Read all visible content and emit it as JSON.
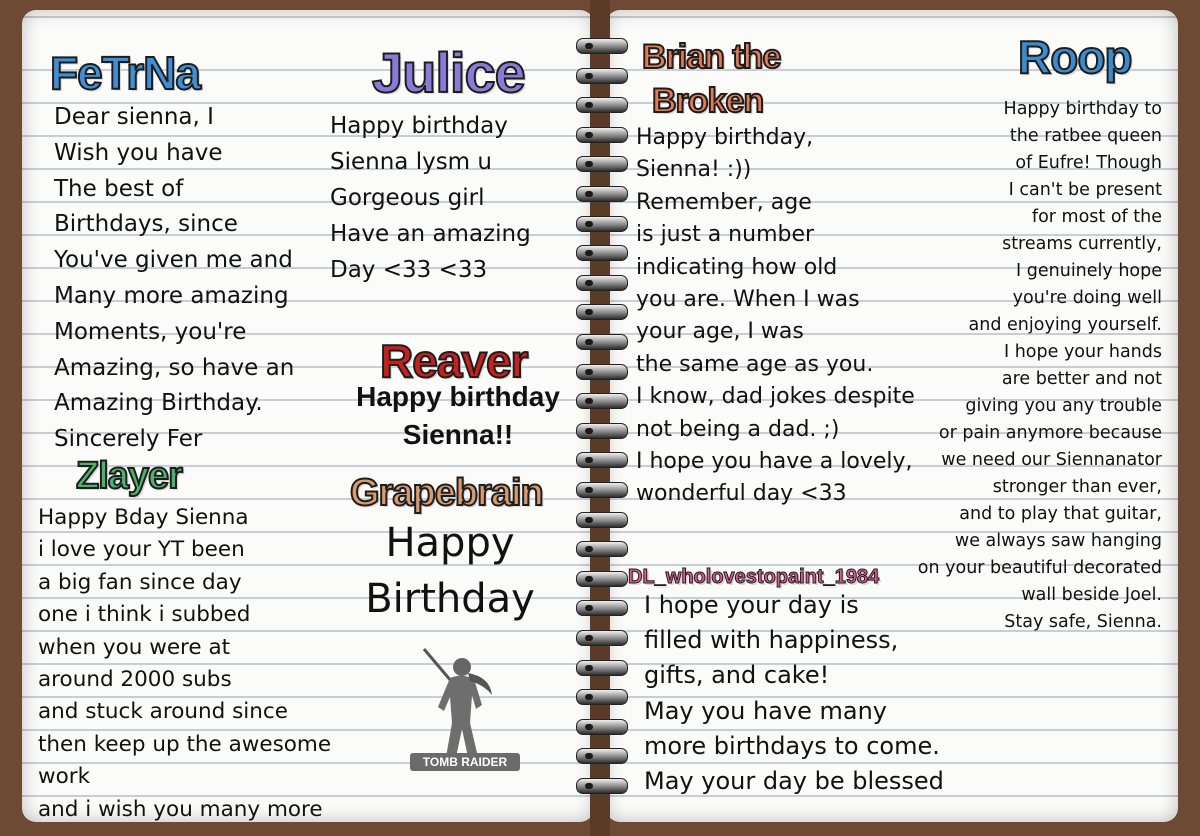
{
  "colors": {
    "fetrna": "#3e8fd6",
    "julice": "#8b7bd8",
    "reaver": "#c8201d",
    "zlayer": "#4bb36a",
    "grapebrain": "#d99a6c",
    "brian": "#e57b55",
    "roop": "#3a8ccc",
    "dl": "#e05a95"
  },
  "left": {
    "fetrna": {
      "name": "FeTrNa",
      "message": "Dear sienna, I\nWish you have\nThe best of\nBirthdays, since\nYou've given me and\nMany more amazing\nMoments, you're\nAmazing, so have an\nAmazing Birthday.\nSincerely Fer"
    },
    "julice": {
      "name": "Julice",
      "message": "Happy birthday\n      Sienna lysm u\n        Gorgeous girl\nHave an amazing\n            Day <33 <33"
    },
    "reaver": {
      "name": "Reaver",
      "message": "Happy birthday\nSienna!!"
    },
    "zlayer": {
      "name": "Zlayer",
      "message": "Happy Bday Sienna\n i love your YT been\n a big fan since day\n one i think i subbed\n when you were at\n around 2000 subs\n and stuck around since\n then keep up the awesome\nwork\n and i wish you many more"
    },
    "grapebrain": {
      "name": "Grapebrain",
      "message": "Happy\nBirthday"
    },
    "logo": {
      "text": "TOMB RAIDER",
      "icon": "lara-croft-silhouette-icon"
    }
  },
  "right": {
    "brian": {
      "name_line1": "Brian the",
      "name_line2": "Broken",
      "message": "Happy birthday,\n Sienna! :))\n  Remember, age\n is just a number\n indicating how old\n you are. When I was\n your age, I was\n the same age as you.\n I know, dad jokes despite\n not being a dad. ;)\n I hope you have a lovely,\n wonderful day <33"
    },
    "roop": {
      "name": "Roop",
      "message": "Happy birthday to\nthe ratbee queen\nof Eufre! Though\nI can't be present\nfor most of the\nstreams currently,\nI genuinely hope\nyou're doing well\nand enjoying yourself.\nI hope your hands\nare better and not\ngiving you any trouble\nor pain anymore because\nwe need our Siennanator\nstronger than ever,\nand to play that guitar,\nwe always saw hanging\non your beautiful decorated\nwall beside Joel.\nStay safe, Sienna."
    },
    "dl": {
      "name": "DL_wholovestopaint_1984",
      "message": "I hope your day is\n filled with happiness,\n gifts, and cake!\n May you have many\n more birthdays to come.\n May your day be blessed"
    }
  }
}
